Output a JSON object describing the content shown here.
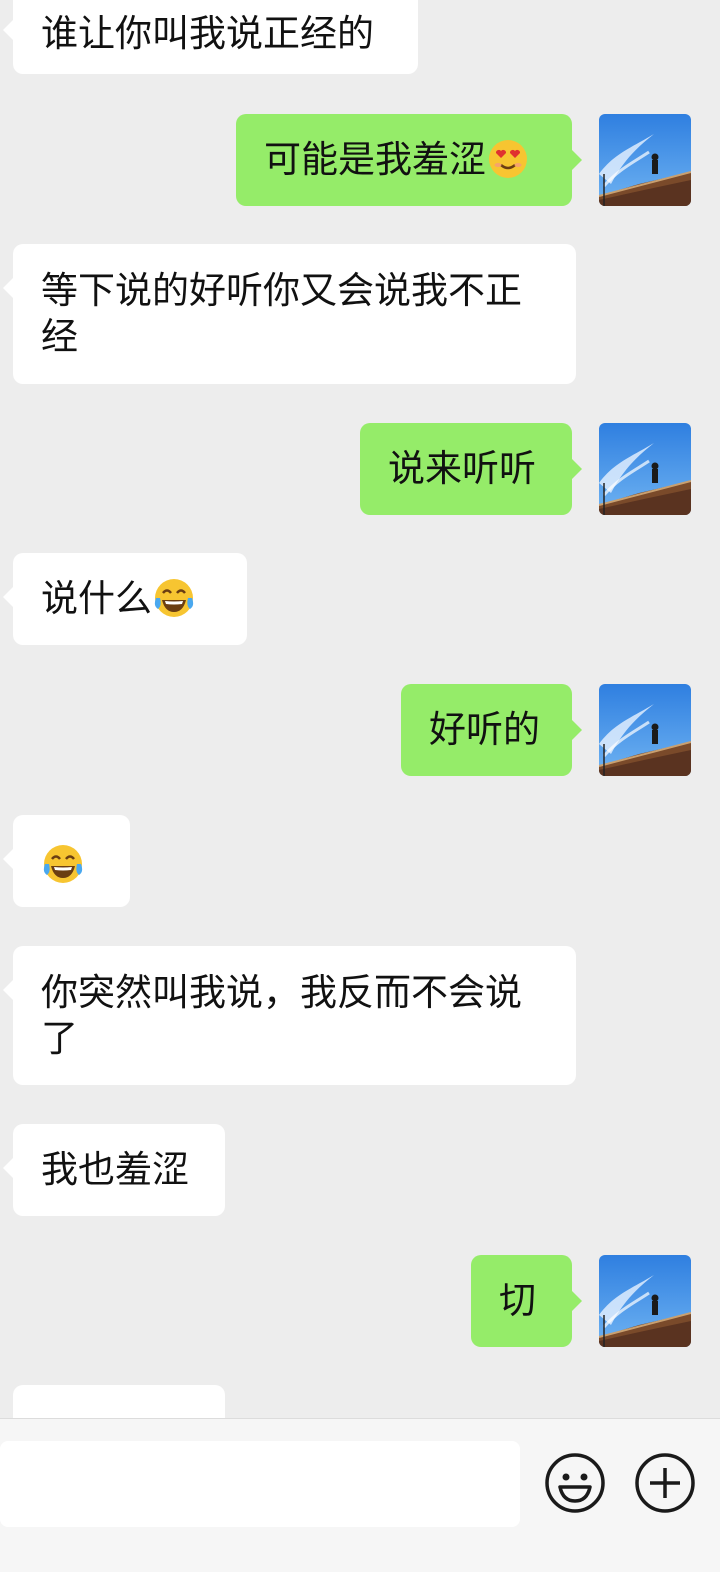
{
  "messages": [
    {
      "side": "in",
      "text": "谁让你叫我说正经的"
    },
    {
      "side": "out",
      "text": "可能是我羞涩",
      "emoji": "heart-eyes-emoji"
    },
    {
      "side": "in",
      "text": "等下说的好听你又会说我不正经"
    },
    {
      "side": "out",
      "text": "说来听听"
    },
    {
      "side": "in",
      "text": "说什么",
      "emoji": "tears-of-joy-emoji"
    },
    {
      "side": "out",
      "text": "好听的"
    },
    {
      "side": "in",
      "text": "",
      "emoji": "tears-of-joy-emoji"
    },
    {
      "side": "in",
      "text": "你突然叫我说，我反而不会说了"
    },
    {
      "side": "in",
      "text": "我也羞涩"
    },
    {
      "side": "out",
      "text": "切"
    }
  ],
  "input": {
    "value": ""
  },
  "toolbar": {
    "emoji_button_icon": "smiley-icon",
    "more_button_icon": "plus-circle-icon"
  },
  "colors": {
    "background": "#ededed",
    "incoming_bubble": "#ffffff",
    "outgoing_bubble": "#95ec69",
    "bottom_bar": "#f6f6f6"
  }
}
